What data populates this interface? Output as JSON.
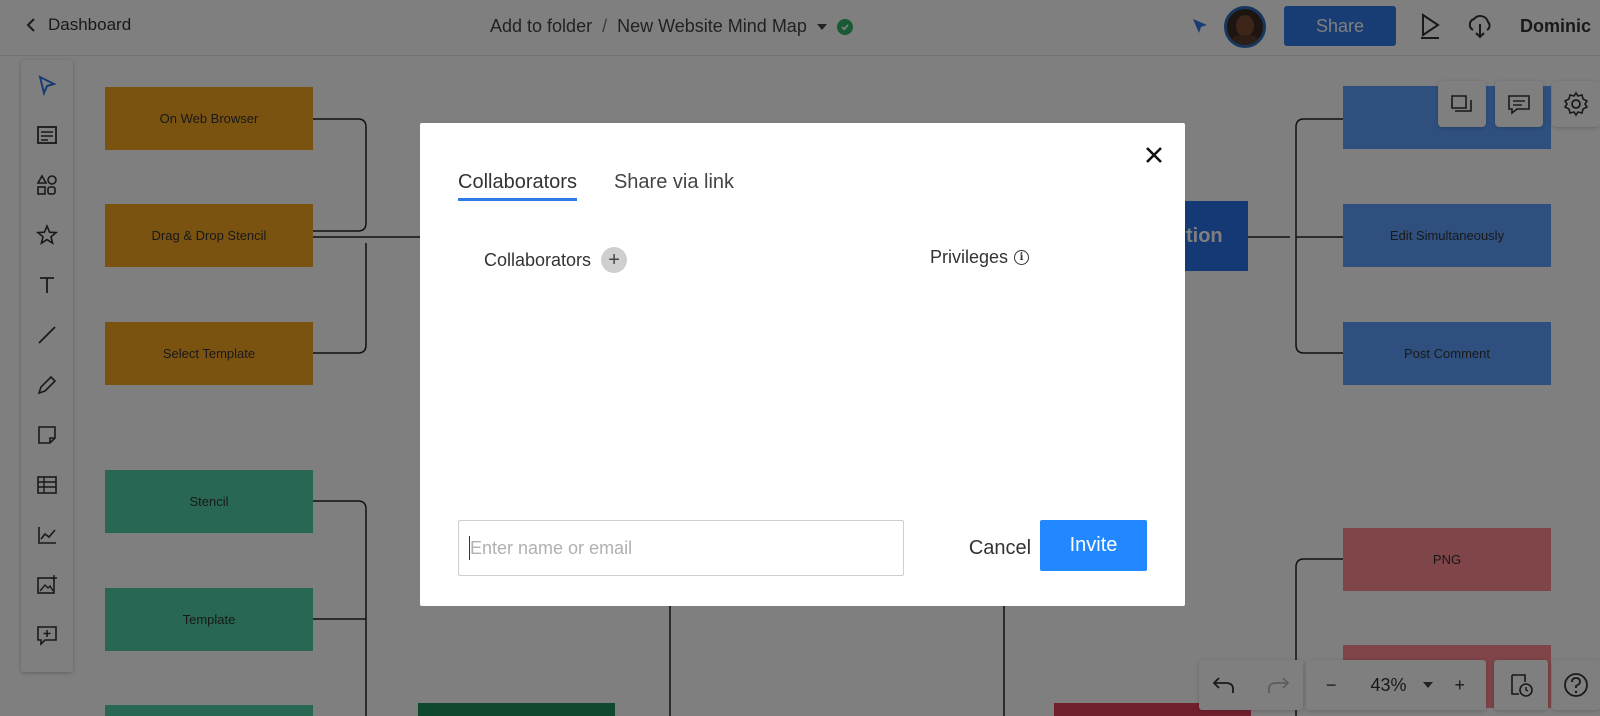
{
  "topbar": {
    "back_label": "Dashboard",
    "folder_label": "Add to folder",
    "separator": "/",
    "doc_title": "New Website Mind Map",
    "share_label": "Share",
    "user_name": "Dominic"
  },
  "canvas": {
    "left_orange": [
      "On Web Browser",
      "Drag & Drop Stencil",
      "Select Template"
    ],
    "left_green": [
      "Stencil",
      "Template"
    ],
    "right_blue": [
      "",
      "Edit Simultaneously",
      "Post Comment"
    ],
    "right_pink": [
      "PNG"
    ],
    "center_fragment": "tion"
  },
  "zoom": {
    "value": "43%",
    "minus": "−",
    "plus": "+"
  },
  "modal": {
    "tabs": [
      "Collaborators",
      "Share via link"
    ],
    "collaborators_heading": "Collaborators",
    "add_symbol": "+",
    "privileges_heading": "Privileges",
    "info_symbol": "i",
    "email_placeholder": "Enter name or email",
    "email_value": "",
    "cancel_label": "Cancel",
    "invite_label": "Invite"
  },
  "colors": {
    "accent": "#2f7be8",
    "invite": "#2288ff",
    "orange_node": "#f6a623",
    "green_node": "#4fcfa6",
    "blue_node": "#5ea0ff",
    "pink_node": "#ff8a92",
    "saved_check": "#2fb46a"
  }
}
